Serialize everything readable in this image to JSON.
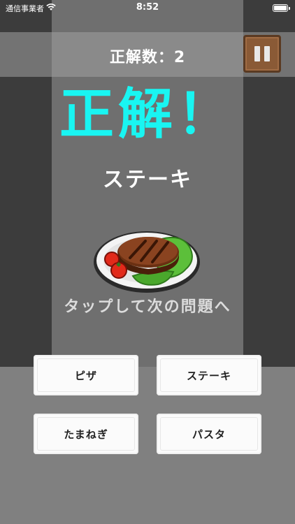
{
  "status_bar": {
    "carrier": "通信事業者",
    "time": "8:52"
  },
  "header": {
    "score_text": "正解数：2",
    "pause_icon": "pause-icon"
  },
  "result": {
    "headline": "正解！",
    "answer": "ステーキ",
    "hint": "タップして次の問題へ",
    "image": "steak-on-plate"
  },
  "choices": [
    {
      "label": "ピザ"
    },
    {
      "label": "ステーキ"
    },
    {
      "label": "たまねぎ"
    },
    {
      "label": "パスタ"
    }
  ],
  "colors": {
    "headline": "#19f5f2",
    "pause_button": "#8a5a36",
    "background": "#808080"
  }
}
